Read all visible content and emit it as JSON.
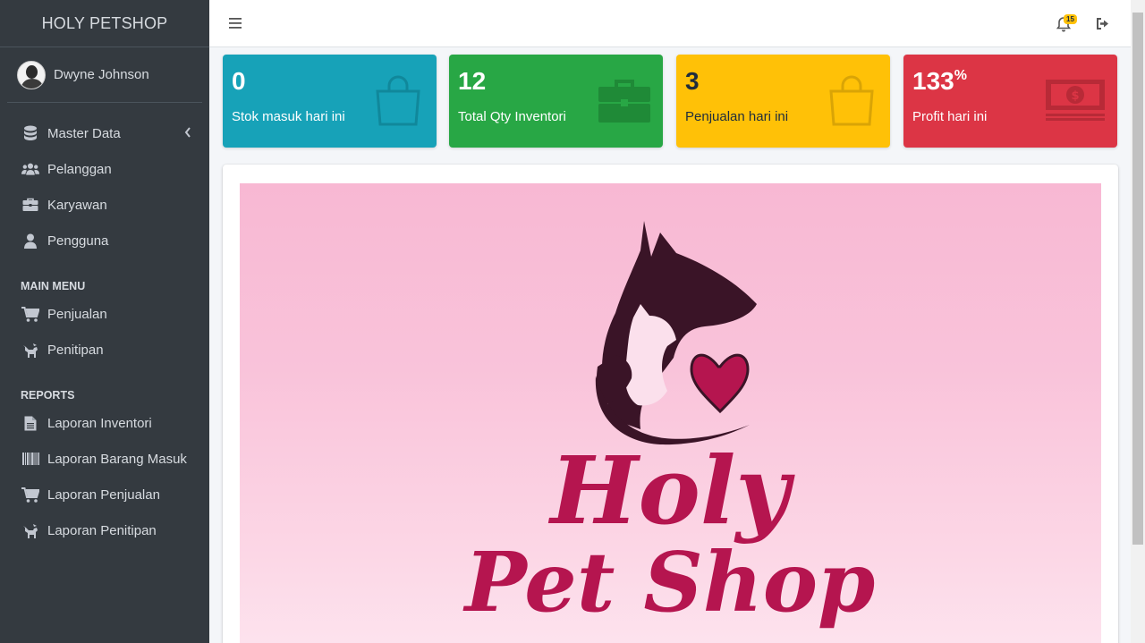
{
  "app": {
    "brand": "HOLY PETSHOP"
  },
  "user": {
    "name": "Dwyne Johnson"
  },
  "sidebar": {
    "items": [
      {
        "label": "Master Data",
        "icon": "database-icon",
        "has_submenu": true
      },
      {
        "label": "Pelanggan",
        "icon": "users-icon"
      },
      {
        "label": "Karyawan",
        "icon": "briefcase-icon"
      },
      {
        "label": "Pengguna",
        "icon": "user-icon"
      }
    ],
    "main_menu_header": "MAIN MENU",
    "main_menu": [
      {
        "label": "Penjualan",
        "icon": "cart-icon"
      },
      {
        "label": "Penitipan",
        "icon": "dog-icon"
      }
    ],
    "reports_header": "REPORTS",
    "reports": [
      {
        "label": "Laporan Inventori",
        "icon": "file-icon"
      },
      {
        "label": "Laporan Barang Masuk",
        "icon": "barcode-icon"
      },
      {
        "label": "Laporan Penjualan",
        "icon": "cart-icon"
      },
      {
        "label": "Laporan Penitipan",
        "icon": "dog-icon"
      }
    ]
  },
  "topbar": {
    "notification_count": "15"
  },
  "stats": [
    {
      "value": "0",
      "label": "Stok masuk hari ini",
      "icon": "shopping-bag-icon",
      "color": "#17a2b8"
    },
    {
      "value": "12",
      "label": "Total Qty Inventori",
      "icon": "briefcase-icon",
      "color": "#28a745"
    },
    {
      "value": "3",
      "label": "Penjualan hari ini",
      "icon": "shopping-bag-icon",
      "color": "#ffc107"
    },
    {
      "value": "133",
      "unit": "%",
      "label": "Profit hari ini",
      "icon": "money-bill-icon",
      "color": "#dc3545"
    }
  ],
  "banner": {
    "logo_line1": "Holy",
    "logo_line2": "Pet Shop",
    "logo_color": "#b5154f",
    "silhouette_color": "#3a1427"
  },
  "colors": {
    "sidebar": "#343a40",
    "content_bg": "#f4f6f9"
  }
}
